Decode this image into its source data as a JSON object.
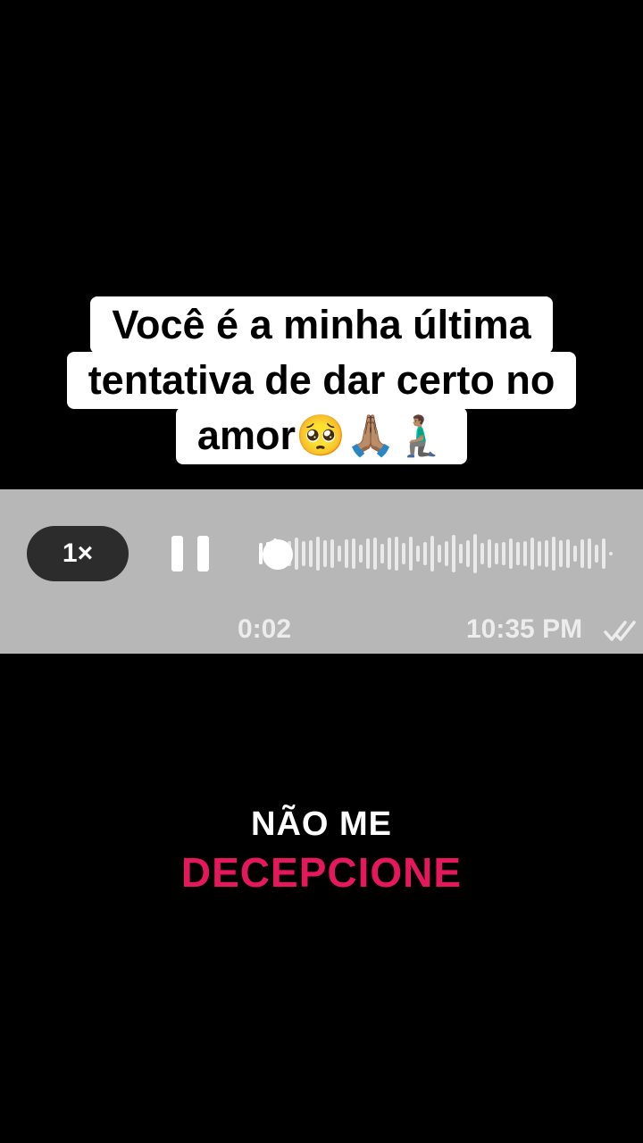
{
  "caption": {
    "lines": [
      "Você é a minha última",
      "tentativa de dar certo no",
      "amor🥺🙏🏽🧎🏽‍♂️"
    ]
  },
  "voice_message": {
    "speed_label": "1×",
    "elapsed": "0:02",
    "sent_time": "10:35 PM",
    "playback_progress": 0.05,
    "state": "playing"
  },
  "title": {
    "line1": "NÃO ME",
    "line2": "DECEPCIONE"
  },
  "colors": {
    "background": "#000000",
    "caption_bg": "#ffffff",
    "voice_bar_bg": "#b7b7b7",
    "speed_pill": "#2c2c2c",
    "accent_pink": "#e6185d"
  },
  "icons": [
    "pause-icon",
    "double-check-icon"
  ]
}
